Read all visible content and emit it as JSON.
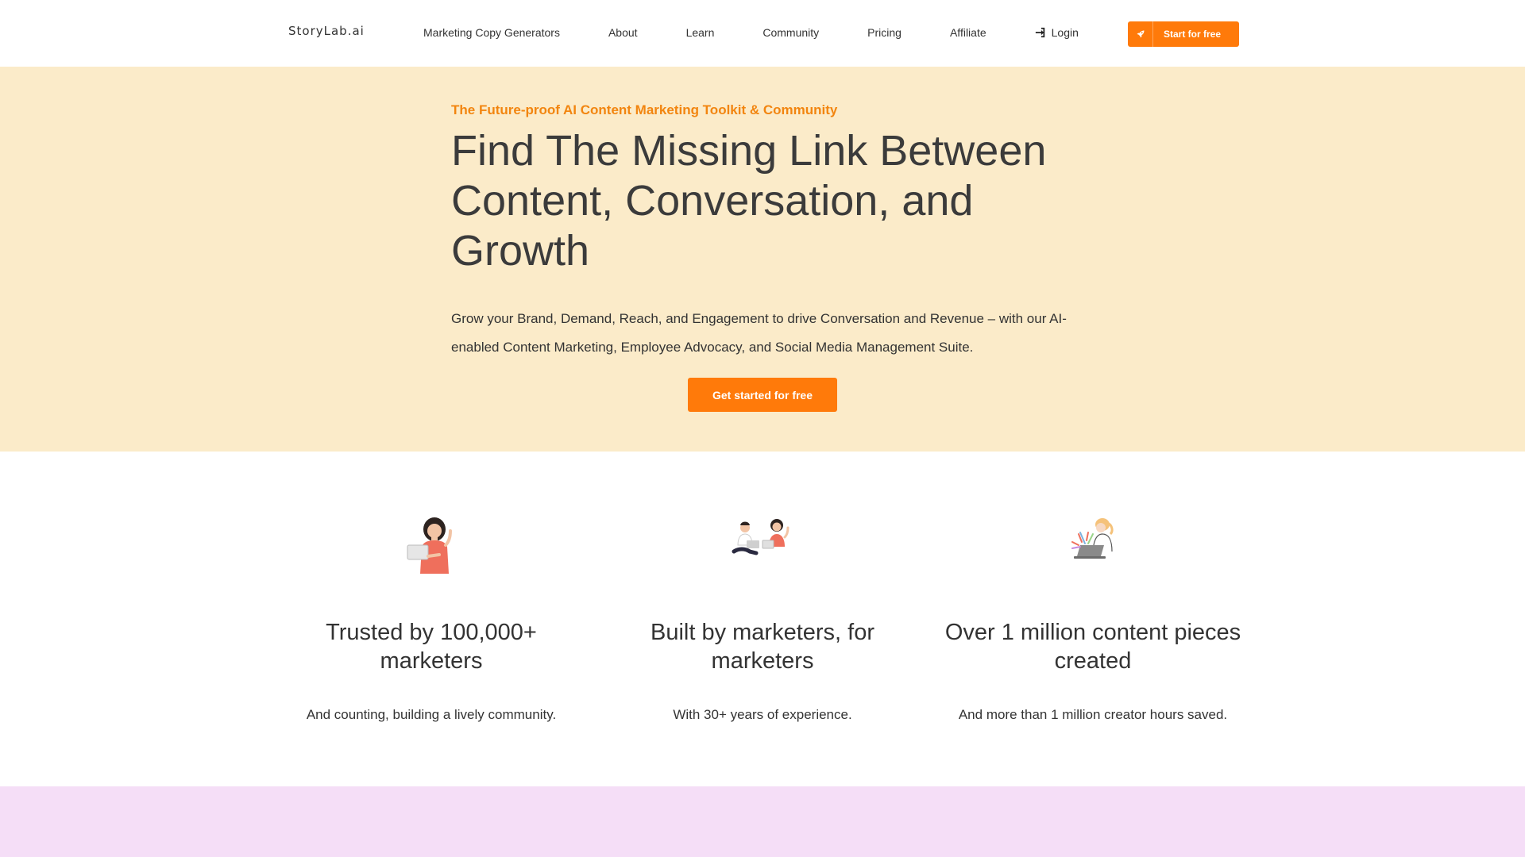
{
  "nav": {
    "logo": "StoryLab.ai",
    "links": [
      "Marketing Copy Generators",
      "About",
      "Learn",
      "Community",
      "Pricing",
      "Affiliate"
    ],
    "login": "Login",
    "login_icon": "sign-in-icon",
    "cta": "Start for free",
    "cta_icon": "rocket-icon"
  },
  "hero": {
    "eyebrow": "The Future-proof AI Content Marketing Toolkit & Community",
    "headline": "Find The Missing Link Between Content, Conversation, and Growth",
    "subtext": "Grow your Brand, Demand, Reach, and Engagement to drive Conversation and Revenue – with our AI-enabled Content Marketing, Employee Advocacy, and Social Media Management Suite.",
    "cta": "Get started for free"
  },
  "features": [
    {
      "title": "Trusted by 100,000+ marketers",
      "desc": "And counting, building a lively community.",
      "icon": "woman-with-laptop-illustration"
    },
    {
      "title": "Built by marketers, for marketers",
      "desc": "With 30+ years of experience.",
      "icon": "two-people-with-laptops-illustration"
    },
    {
      "title": "Over 1 million content pieces created",
      "desc": "And more than 1 million creator hours saved.",
      "icon": "creator-at-laptop-illustration"
    }
  ],
  "colors": {
    "accent": "#ff7a0a",
    "eyebrow": "#f2850f",
    "hero_bg": "#fbebc9",
    "bottom_band": "#f5def7"
  }
}
